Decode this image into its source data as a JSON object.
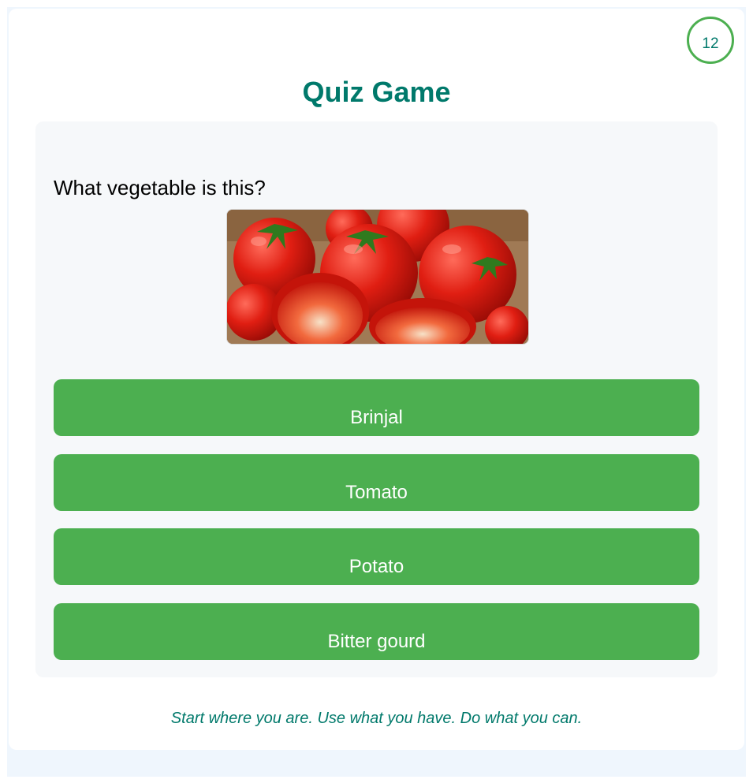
{
  "timer": {
    "value": "12"
  },
  "header": {
    "title": "Quiz Game"
  },
  "quiz": {
    "question": "What vegetable is this?",
    "image_icon": "tomatoes-photo",
    "options": [
      {
        "label": "Brinjal"
      },
      {
        "label": "Tomato"
      },
      {
        "label": "Potato"
      },
      {
        "label": "Bitter gourd"
      }
    ]
  },
  "footer": {
    "quote": "Start where you are. Use what you have. Do what you can."
  },
  "colors": {
    "accent": "#4caf50",
    "title": "#00796b",
    "panel": "#f6f8fa",
    "page_bg": "#eff6fd"
  }
}
